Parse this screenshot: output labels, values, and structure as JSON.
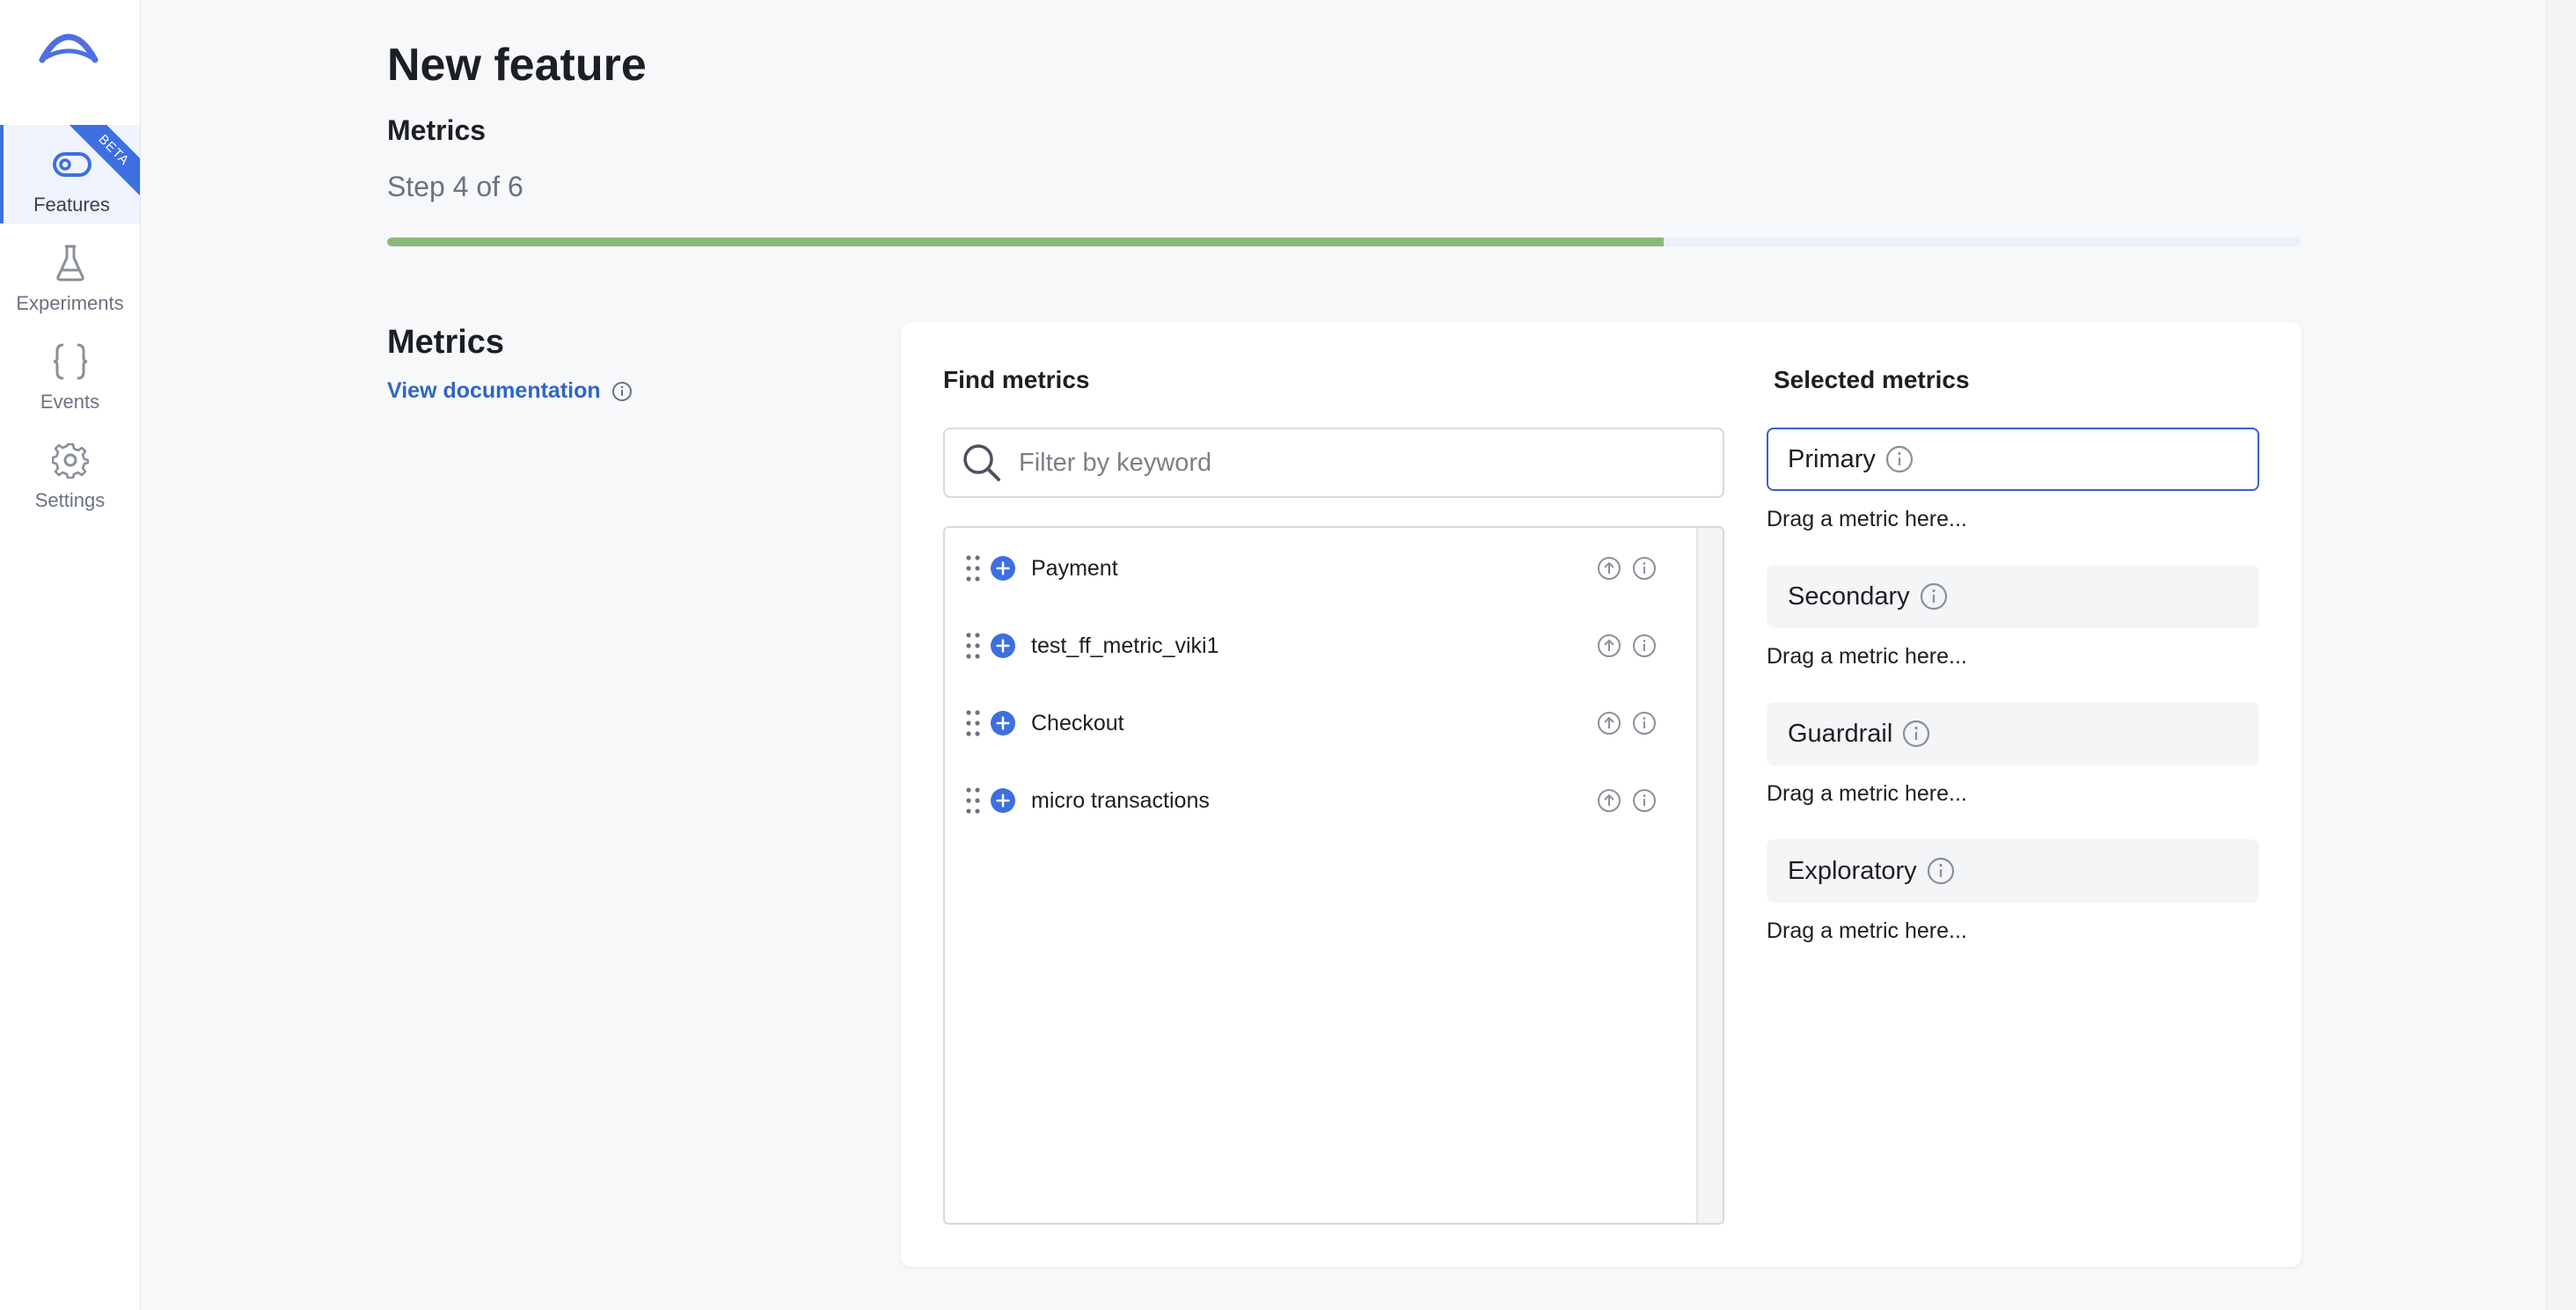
{
  "sidebar": {
    "logo": "logo-icon",
    "items": [
      {
        "label": "Features",
        "icon": "toggle-icon",
        "badge": "BETA",
        "active": true
      },
      {
        "label": "Experiments",
        "icon": "flask-icon"
      },
      {
        "label": "Events",
        "icon": "braces-icon"
      },
      {
        "label": "Settings",
        "icon": "gear-icon"
      }
    ]
  },
  "header": {
    "title": "New feature",
    "step_name": "Metrics",
    "step_count": "Step 4 of 6",
    "progress": 0.667
  },
  "section": {
    "title": "Metrics",
    "doc_link": "View documentation"
  },
  "find": {
    "title": "Find metrics",
    "search_placeholder": "Filter by keyword",
    "search_value": "",
    "metrics": [
      {
        "name": "Payment"
      },
      {
        "name": "test_ff_metric_viki1"
      },
      {
        "name": "Checkout"
      },
      {
        "name": "micro transactions"
      }
    ]
  },
  "selected": {
    "title": "Selected metrics",
    "slots": [
      {
        "label": "Primary",
        "hint": "Drag a metric here..."
      },
      {
        "label": "Secondary",
        "hint": "Drag a metric here..."
      },
      {
        "label": "Guardrail",
        "hint": "Drag a metric here..."
      },
      {
        "label": "Exploratory",
        "hint": "Drag a metric here..."
      }
    ]
  },
  "colors": {
    "accent": "#3d6fe0",
    "progress": "#8ab87a",
    "link": "#2f67c4"
  }
}
